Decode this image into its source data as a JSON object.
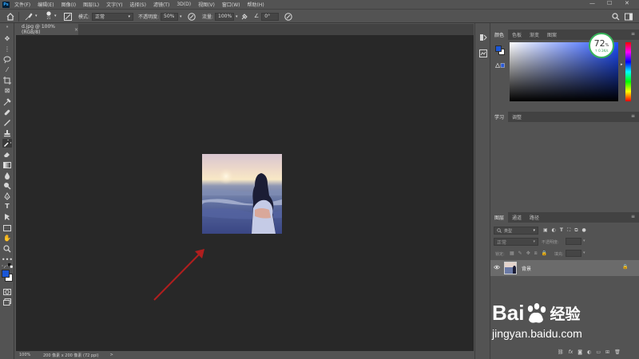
{
  "app": {
    "logo": "Ps"
  },
  "menu": [
    "文件(F)",
    "编辑(E)",
    "图像(I)",
    "图层(L)",
    "文字(Y)",
    "选择(S)",
    "滤镜(T)",
    "3D(D)",
    "视图(V)",
    "窗口(W)",
    "帮助(H)"
  ],
  "window_controls": {
    "minimize": "—",
    "maximize": "☐",
    "close": "✕"
  },
  "options": {
    "brush_size": "21",
    "mode_label": "模式:",
    "mode_value": "正常",
    "opacity_label": "不透明度:",
    "opacity_value": "50%",
    "flow_label": "流量:",
    "flow_value": "100%",
    "angle_value": "0°"
  },
  "document": {
    "tab_title": "d.jpg @ 100%(RGB/8)",
    "close": "×",
    "zoom": "100%",
    "info": "200 像素 x 200 像素 (72 ppi)",
    "status_arrow": ">"
  },
  "color_panel": {
    "tabs": [
      "颜色",
      "色板",
      "渐变",
      "图案"
    ],
    "fg_color": "#1a56d6",
    "bg_color": "#ffffff",
    "gradient_hue": "#1f4fff"
  },
  "learn_panel": {
    "tabs": [
      "学习",
      "调整"
    ]
  },
  "layers_panel": {
    "tabs": [
      "图层",
      "通道",
      "路径"
    ],
    "filter_placeholder": "类型",
    "blend_mode": "正常",
    "opacity_label": "不透明度:",
    "lock_label": "锁定:",
    "fill_label": "填充:",
    "layer_name": "背景"
  },
  "perf_widget": {
    "percent": "72",
    "percent_sign": "%",
    "speed": "↑ 0.1K/s"
  },
  "watermark": {
    "brand": "Bai",
    "brand_suffix": "经验",
    "url": "jingyan.baidu.com"
  },
  "colors": {
    "arrow": "#b01e1e",
    "accent": "#1473e6"
  }
}
